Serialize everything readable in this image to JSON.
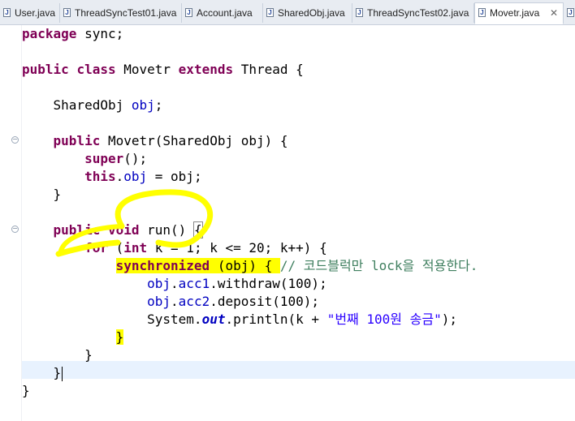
{
  "tabs": [
    {
      "label": "User.java"
    },
    {
      "label": "ThreadSyncTest01.java"
    },
    {
      "label": "Account.java"
    },
    {
      "label": "SharedObj.java"
    },
    {
      "label": "ThreadSyncTest02.java"
    },
    {
      "label": "Movetr.java",
      "active": true,
      "close": "✕"
    }
  ],
  "code": {
    "l1_kw": "package",
    "l1_rest": " sync;",
    "l3_kw1": "public",
    "l3_kw2": "class",
    "l3_name": " Movetr ",
    "l3_kw3": "extends",
    "l3_rest": " Thread {",
    "l5_type": "SharedObj ",
    "l5_field": "obj",
    "l5_end": ";",
    "l7_kw": "public",
    "l7_rest": " Movetr(SharedObj obj) {",
    "l8_kw": "super",
    "l8_rest": "();",
    "l9_kw": "this",
    "l9_dot": ".",
    "l9_field": "obj",
    "l9_rest": " = obj;",
    "l10": "}",
    "l12_kw1": "public",
    "l12_kw2": "void",
    "l12_rest": " run() ",
    "l12_brace": "{",
    "l13_kw1": "for",
    "l13_a": " (",
    "l13_kw2": "int",
    "l13_rest": " k = 1; k <= 20; k++) {",
    "l14_kw": "synchronized",
    "l14_rest": " (obj) { ",
    "l14_cmt": "// 코드블럭만 lock을 적용한다.",
    "l15_field1": "obj",
    "l15_dot": ".",
    "l15_field2": "acc1",
    "l15_rest": ".withdraw(100);",
    "l16_field1": "obj",
    "l16_dot": ".",
    "l16_field2": "acc2",
    "l16_rest": ".deposit(100);",
    "l17_a": "System.",
    "l17_stat": "out",
    "l17_b": ".println(k + ",
    "l17_str": "\"번째 100원 송금\"",
    "l17_c": ");",
    "l18": "}",
    "l19": "}",
    "l20": "}",
    "l21": "}"
  },
  "colors": {
    "keyword": "#7f0055",
    "field": "#0000c0",
    "string": "#2a00ff",
    "comment": "#3f7f5f",
    "highlight": "#ffff00",
    "current_line": "#e8f2fe"
  },
  "icons": {
    "file": "java-file-icon",
    "fold": "collapse-minus-icon",
    "close": "close-icon"
  }
}
